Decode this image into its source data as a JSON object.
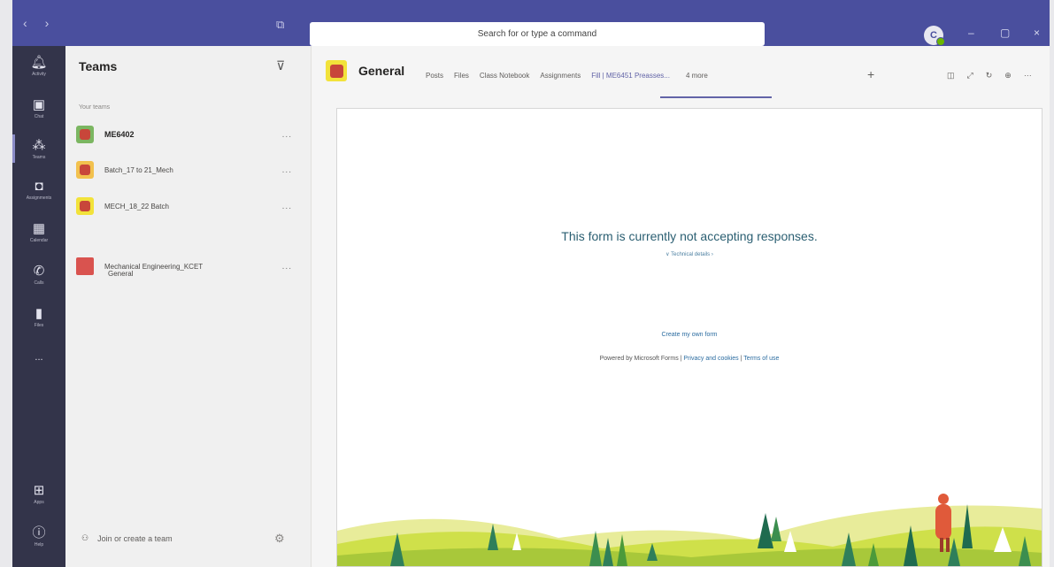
{
  "titlebar": {
    "search_placeholder": "Search for or type a command",
    "avatar_initial": "C"
  },
  "rail": {
    "items": [
      {
        "label": "Activity",
        "icon": "bell-icon"
      },
      {
        "label": "Chat",
        "icon": "chat-icon"
      },
      {
        "label": "Teams",
        "icon": "teams-icon"
      },
      {
        "label": "Assignments",
        "icon": "assignments-icon"
      },
      {
        "label": "Calendar",
        "icon": "calendar-icon"
      },
      {
        "label": "Calls",
        "icon": "phone-icon"
      },
      {
        "label": "Files",
        "icon": "file-icon"
      },
      {
        "label": "...",
        "icon": "more-icon"
      },
      {
        "label": "Apps",
        "icon": "apps-icon"
      },
      {
        "label": "Help",
        "icon": "help-icon"
      }
    ]
  },
  "panel": {
    "title": "Teams",
    "section_label": "Your teams",
    "teams": [
      {
        "name": "ME6402",
        "more": "...",
        "tile_color": "#7bb661"
      },
      {
        "name": "Batch_17 to 21_Mech",
        "more": "...",
        "tile_color": "#f2c14e"
      },
      {
        "name": "MECH_18_22 Batch",
        "more": "...",
        "tile_color": "#f2e23a"
      },
      {
        "name": "Mechanical Engineering_KCET",
        "more": "...",
        "tile_color": "#d9534f"
      }
    ],
    "channel": "General",
    "join_label": "Join or create a team"
  },
  "main": {
    "channel_title": "General",
    "tabs": [
      "Posts",
      "Files",
      "Class Notebook",
      "Assignments",
      "Fill | ME6451 Preasses...",
      "4 more"
    ],
    "active_tab": 4
  },
  "form": {
    "message": "This form is currently not accepting responses.",
    "technical_details": "Technical details",
    "create_link": "Create my own form",
    "powered_by": "Powered by Microsoft Forms |",
    "privacy": "Privacy and cookies",
    "separator": "|",
    "terms": "Terms of use"
  },
  "colors": {
    "titlebar": "#4a4f9e",
    "rail": "#33344a",
    "accent": "#6264a7",
    "team_tile_red": "#c8463a"
  }
}
